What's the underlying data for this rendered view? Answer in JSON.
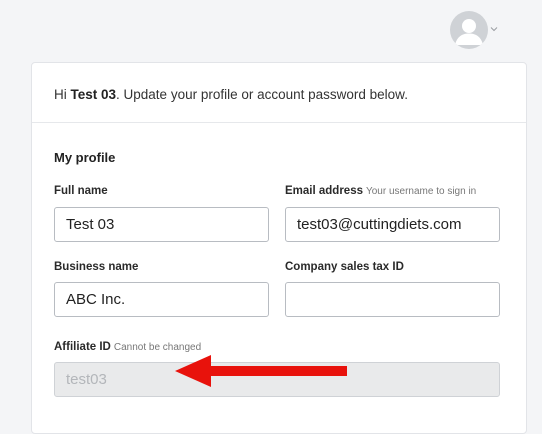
{
  "header": {
    "avatar_icon": "user-avatar-icon",
    "menu_icon": "chevron-down-icon"
  },
  "profile": {
    "greeting_prefix": "Hi ",
    "user_name": "Test 03",
    "greeting_suffix": ". Update your profile or account password below.",
    "section_title": "My profile",
    "fields": {
      "full_name": {
        "label": "Full name",
        "value": "Test 03"
      },
      "email": {
        "label": "Email address",
        "hint": "Your username to sign in",
        "value": "test03@cuttingdiets.com"
      },
      "business_name": {
        "label": "Business name",
        "value": "ABC Inc."
      },
      "sales_tax_id": {
        "label": "Company sales tax ID",
        "value": ""
      },
      "affiliate_id": {
        "label": "Affiliate ID",
        "hint": "Cannot be changed",
        "value": "test03"
      }
    }
  },
  "annotation": {
    "arrow_color": "#e8120c"
  }
}
